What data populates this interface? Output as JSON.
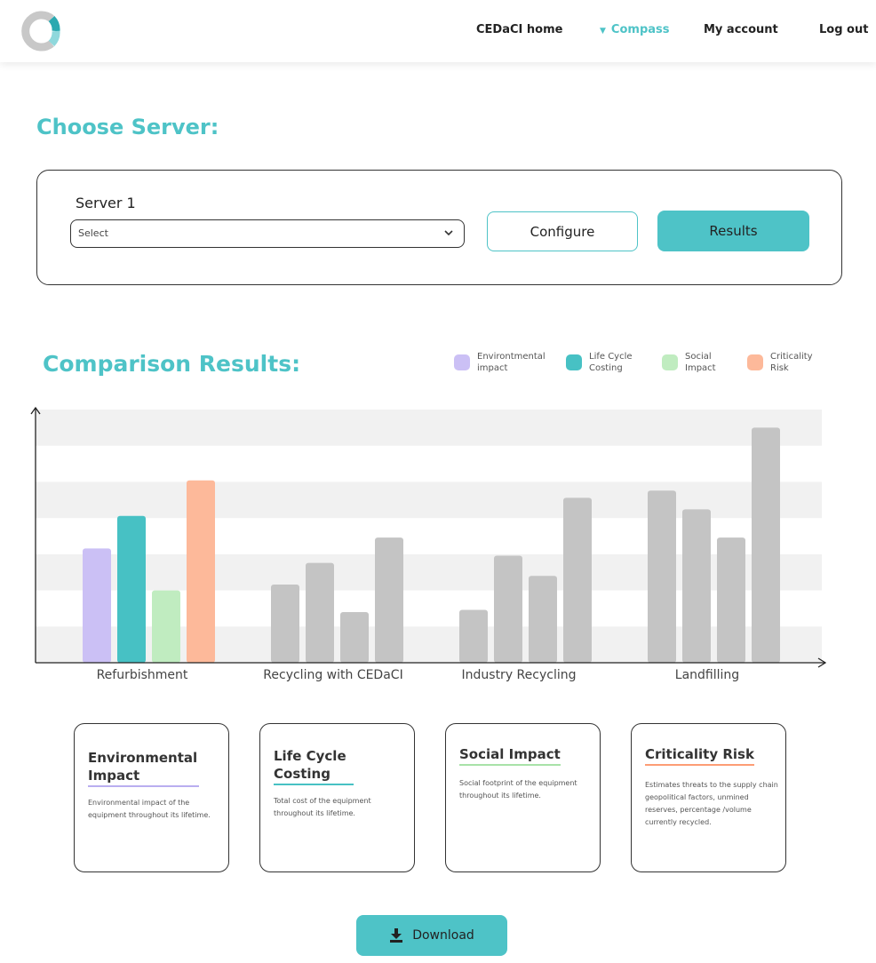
{
  "nav": {
    "home": "CEDaCI home",
    "compass": "Compass",
    "account": "My account",
    "logout": "Log out"
  },
  "server_section": {
    "title": "Choose Server:",
    "server_label": "Server 1",
    "select_placeholder": "Select",
    "configure_label": "Configure",
    "results_label": "Results"
  },
  "comparison": {
    "title": "Comparison Results:"
  },
  "legend": [
    {
      "label": "Environtmental impact",
      "color": "#cbc0f5"
    },
    {
      "label": "Life Cycle Costing",
      "color": "#47c1c4"
    },
    {
      "label": "Social Impact",
      "color": "#c0ecc0"
    },
    {
      "label": "Criticality Risk",
      "color": "#fdb99a"
    }
  ],
  "chart_data": {
    "type": "bar",
    "categories": [
      "Refurbishment",
      "Recycling with CEDaCI",
      "Industry Recycling",
      "Landfilling"
    ],
    "series": [
      {
        "name": "Environtmental impact",
        "values": [
          1.58,
          1.08,
          0.73,
          2.38
        ]
      },
      {
        "name": "Life Cycle Costing",
        "values": [
          2.03,
          1.38,
          1.48,
          2.12
        ]
      },
      {
        "name": "Social Impact",
        "values": [
          1.0,
          0.7,
          1.2,
          1.73
        ]
      },
      {
        "name": "Criticality Risk",
        "values": [
          2.52,
          1.73,
          2.28,
          3.25
        ]
      }
    ],
    "highlighted_category": "Refurbishment",
    "inactive_color": "#c4c4c4",
    "ylim": [
      0,
      3.5
    ],
    "bands": 7,
    "grid": "alternating horizontal bands"
  },
  "cards": [
    {
      "title": "Environmental Impact",
      "description": "Environmental impact of the equipment throughout its lifetime.",
      "accent": "#b9aef0"
    },
    {
      "title": "Life Cycle Costing",
      "description": "Total cost of the equipment throughout its lifetime.",
      "accent": "#47c1c4"
    },
    {
      "title": "Social Impact",
      "description": "Social footprint of the equipment throughout its lifetime.",
      "accent": "#a8e2a8"
    },
    {
      "title": "Criticality Risk",
      "description": "Estimates threats to the supply chain geopolitical factors, unmined reserves, percentage /volume currently recycled.",
      "accent": "#fd9d75"
    }
  ],
  "download_label": "Download",
  "colors": {
    "accent": "#4ec3c7",
    "text": "#222222"
  }
}
